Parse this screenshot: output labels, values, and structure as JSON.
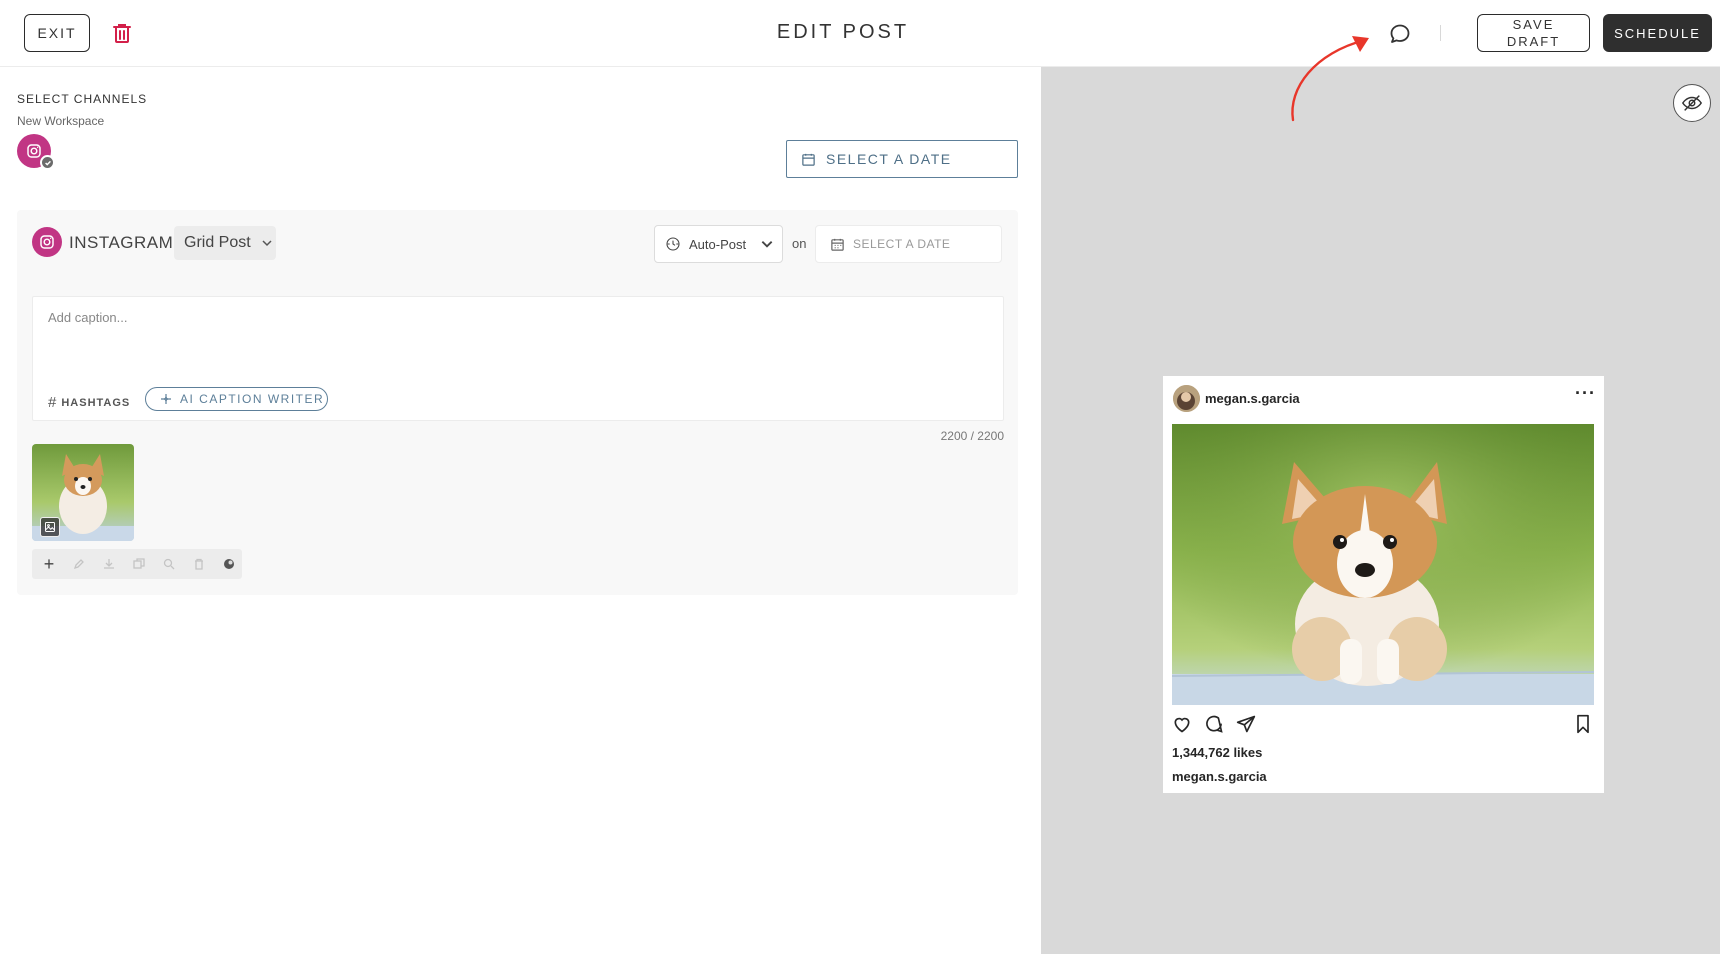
{
  "header": {
    "exit_label": "EXIT",
    "title": "EDIT POST",
    "save_label": "SAVE DRAFT",
    "schedule_label": "SCHEDULE"
  },
  "channels": {
    "heading": "SELECT CHANNELS",
    "workspace": "New Workspace",
    "date_button": "SELECT A DATE"
  },
  "instagram": {
    "title": "INSTAGRAM",
    "post_type": "Grid Post",
    "publish_mode": "Auto-Post",
    "on_label": "on",
    "date_placeholder": "SELECT A DATE",
    "caption_placeholder": "Add caption...",
    "hashtags_label": "HASHTAGS",
    "ai_label": "AI CAPTION WRITER",
    "char_counter": "2200 / 2200"
  },
  "preview": {
    "username": "megan.s.garcia",
    "likes": "1,344,762 likes",
    "caption_username": "megan.s.garcia"
  },
  "colors": {
    "instagram": "#c13584",
    "accent": "#5d7f99",
    "schedule_bg": "#2f2f2f",
    "preview_bg": "#d9d9d9",
    "annotation_arrow": "#e8362a"
  }
}
